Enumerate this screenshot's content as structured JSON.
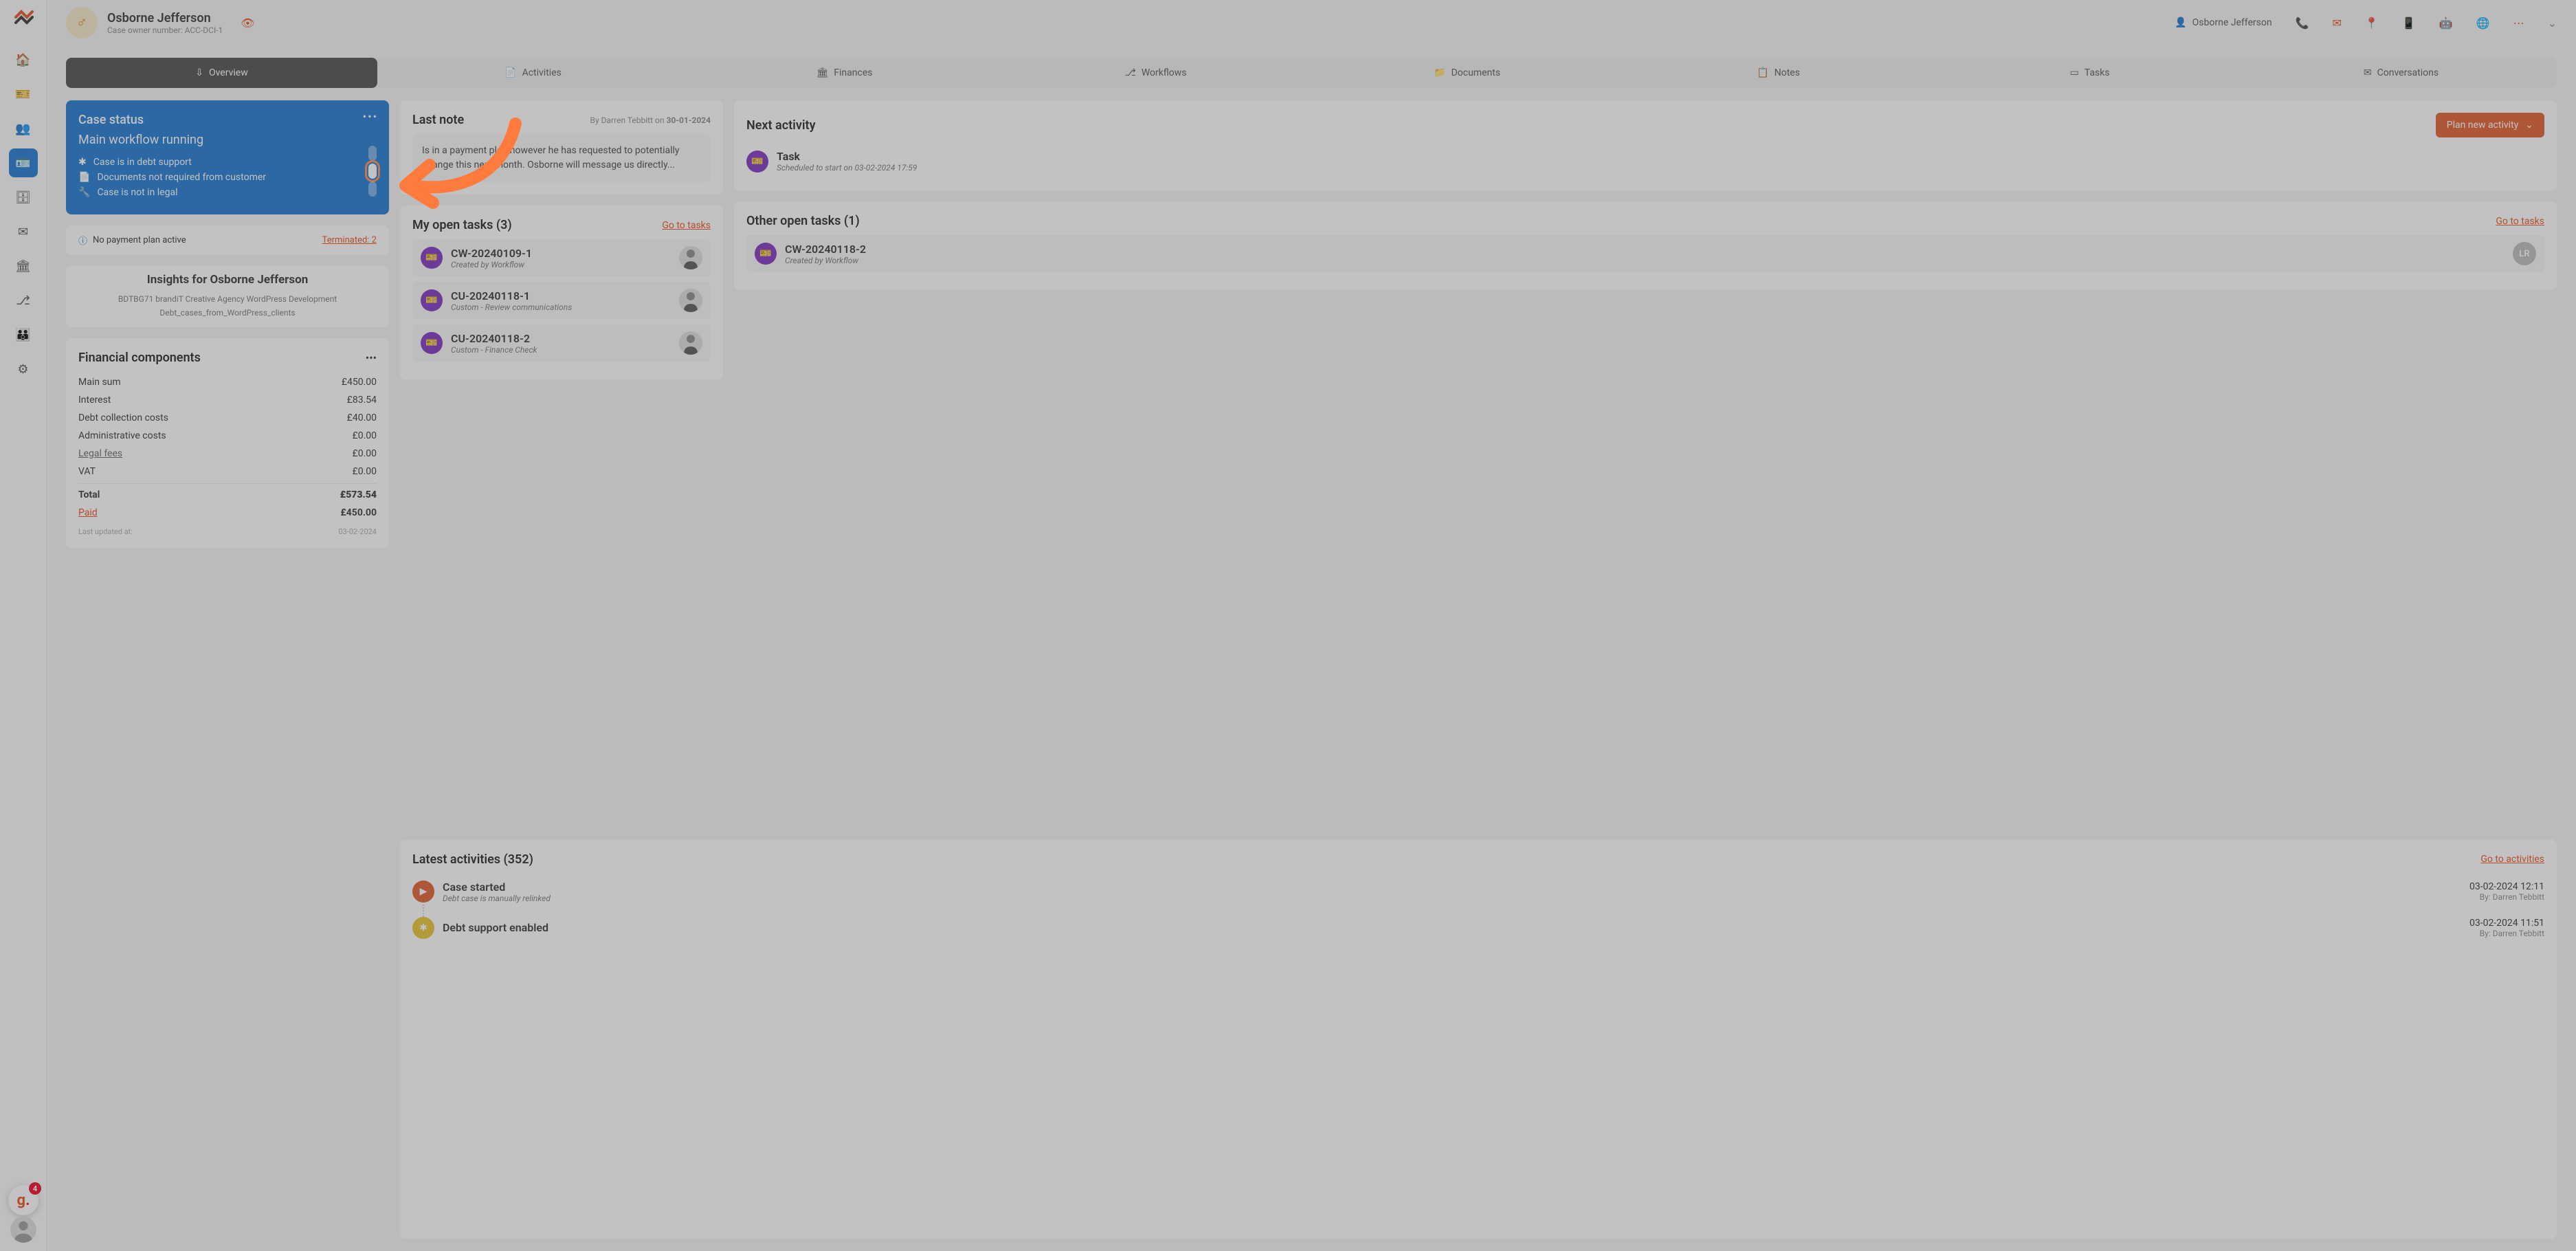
{
  "header": {
    "name": "Osborne Jefferson",
    "owner_line": "Case owner number: ACC-DCI-1",
    "user_label": "Osborne Jefferson"
  },
  "tabs": [
    {
      "icon": "⇩",
      "label": "Overview"
    },
    {
      "icon": "📄",
      "label": "Activities"
    },
    {
      "icon": "🏛",
      "label": "Finances"
    },
    {
      "icon": "⎇",
      "label": "Workflows"
    },
    {
      "icon": "📁",
      "label": "Documents"
    },
    {
      "icon": "📋",
      "label": "Notes"
    },
    {
      "icon": "▭",
      "label": "Tasks"
    },
    {
      "icon": "✉",
      "label": "Conversations"
    }
  ],
  "case_status": {
    "title": "Case status",
    "subtitle": "Main workflow running",
    "lines": [
      {
        "icon": "✱",
        "text": "Case is in debt support"
      },
      {
        "icon": "📄",
        "text": "Documents not required from customer"
      },
      {
        "icon": "🔧",
        "text": "Case is not in legal"
      }
    ]
  },
  "payment_bar": {
    "text": "No payment plan active",
    "right": "Terminated: 2"
  },
  "insights": {
    "title": "Insights for Osborne Jefferson",
    "tags_line1": "BDTBG71    brandiT Creative Agency    WordPress Development",
    "tags_line2": "Debt_cases_from_WordPress_clients"
  },
  "fin_comp": {
    "title": "Financial components",
    "rows": [
      {
        "label": "Main sum",
        "value": "£450.00"
      },
      {
        "label": "Interest",
        "value": "£83.54"
      },
      {
        "label": "Debt collection costs",
        "value": "£40.00"
      },
      {
        "label": "Administrative costs",
        "value": "£0.00"
      },
      {
        "label": "Legal fees",
        "value": "£0.00",
        "link": true
      },
      {
        "label": "VAT",
        "value": "£0.00"
      }
    ],
    "total_label": "Total",
    "total_value": "£573.54",
    "paid_label": "Paid",
    "paid_value": "£450.00",
    "updated_label": "Last updated at:",
    "updated_value": "03-02-2024"
  },
  "last_note": {
    "title": "Last note",
    "by": "By Darren Tebbitt on",
    "date": "30-01-2024",
    "body": "Is in a payment plan however he has requested to potentially change this next month. Osborne will message us directly..."
  },
  "next_activity": {
    "title": "Next activity",
    "button": "Plan new activity",
    "row_title": "Task",
    "row_sub": "Scheduled to start on 03-02-2024 17:59"
  },
  "my_tasks": {
    "title": "My open tasks (3)",
    "link": "Go to tasks",
    "items": [
      {
        "name": "CW-20240109-1",
        "sub": "Created by Workflow"
      },
      {
        "name": "CU-20240118-1",
        "sub": "Custom - Review communications"
      },
      {
        "name": "CU-20240118-2",
        "sub": "Custom - Finance Check"
      }
    ]
  },
  "other_tasks": {
    "title": "Other open tasks (1)",
    "link": "Go to tasks",
    "items": [
      {
        "name": "CW-20240118-2",
        "sub": "Created by Workflow",
        "avatar": "LR"
      }
    ]
  },
  "latest": {
    "title": "Latest activities (352)",
    "link": "Go to activities",
    "items": [
      {
        "icon": "orange",
        "glyph": "▶",
        "title": "Case started",
        "sub": "Debt case is manually relinked",
        "ts": "03-02-2024 12:11",
        "by": "By: Darren Tebbitt"
      },
      {
        "icon": "yellow",
        "glyph": "✱",
        "title": "Debt support enabled",
        "sub": "",
        "ts": "03-02-2024 11:51",
        "by": "By: Darren Tebbitt"
      }
    ]
  },
  "notif_count": "4"
}
